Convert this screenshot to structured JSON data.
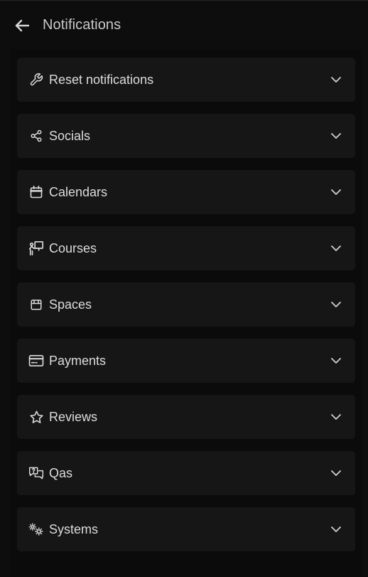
{
  "header": {
    "title": "Notifications",
    "back_icon": "arrow-left-icon"
  },
  "items": [
    {
      "label": "Reset notifications",
      "icon": "wrench-icon"
    },
    {
      "label": "Socials",
      "icon": "share-icon"
    },
    {
      "label": "Calendars",
      "icon": "calendar-icon"
    },
    {
      "label": "Courses",
      "icon": "teacher-board-icon"
    },
    {
      "label": "Spaces",
      "icon": "box-icon"
    },
    {
      "label": "Payments",
      "icon": "credit-card-icon"
    },
    {
      "label": "Reviews",
      "icon": "star-icon"
    },
    {
      "label": "Qas",
      "icon": "chat-question-icon"
    },
    {
      "label": "Systems",
      "icon": "gears-icon"
    }
  ],
  "colors": {
    "background": "#0d0d0d",
    "row": "#161616",
    "text": "#dcdcdc",
    "title": "#c9c9c9"
  }
}
